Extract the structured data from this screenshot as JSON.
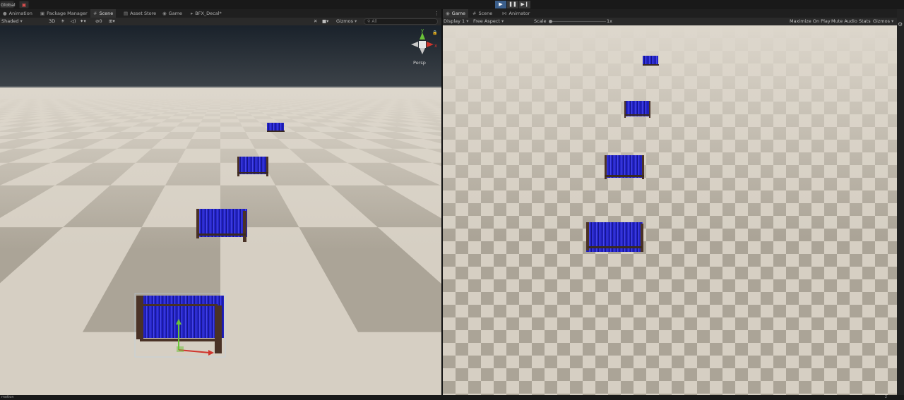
{
  "toolbar": {
    "layer_label": "Global",
    "play_icon": "play-icon",
    "pause_icon": "pause-icon",
    "step_icon": "step-icon",
    "accent": "#3b5f8c"
  },
  "left_tabs": [
    {
      "label": "Animation",
      "icon": "●"
    },
    {
      "label": "Package Manager",
      "icon": "▣"
    },
    {
      "label": "Scene",
      "icon": "#"
    },
    {
      "label": "Asset Store",
      "icon": "▤"
    },
    {
      "label": "Game",
      "icon": "◉"
    },
    {
      "label": "BFX_Decal*",
      "icon": "▸"
    }
  ],
  "right_tabs": [
    {
      "label": "Game",
      "icon": "◉"
    },
    {
      "label": "Scene",
      "icon": "#"
    },
    {
      "label": "Animator",
      "icon": "⋈"
    }
  ],
  "scene_controls": {
    "shading_mode": "Shaded",
    "mode_2d3d": "3D",
    "count": "0",
    "gizmos": "Gizmos",
    "search_placeholder": "All"
  },
  "game_controls": {
    "display": "Display 1",
    "aspect": "Free Aspect",
    "scale_label": "Scale",
    "scale_value": "1x",
    "maximize": "Maximize On Play",
    "mute": "Mute Audio",
    "stats": "Stats",
    "gizmos": "Gizmos"
  },
  "scene_gizmo": {
    "projection": "Persp",
    "axis_y": "y",
    "axis_x": "x",
    "axis_y_color": "#6ac238",
    "axis_x_color": "#d0352d"
  },
  "colors": {
    "floor_light": "#d6cfc3",
    "floor_dark": "#aba497",
    "fence_blue": "#2424c8",
    "fence_post": "#4a3226",
    "sky_top": "#1a222b",
    "sky_bottom": "#3b4148"
  },
  "status": {
    "left": "motion",
    "right": "2"
  }
}
